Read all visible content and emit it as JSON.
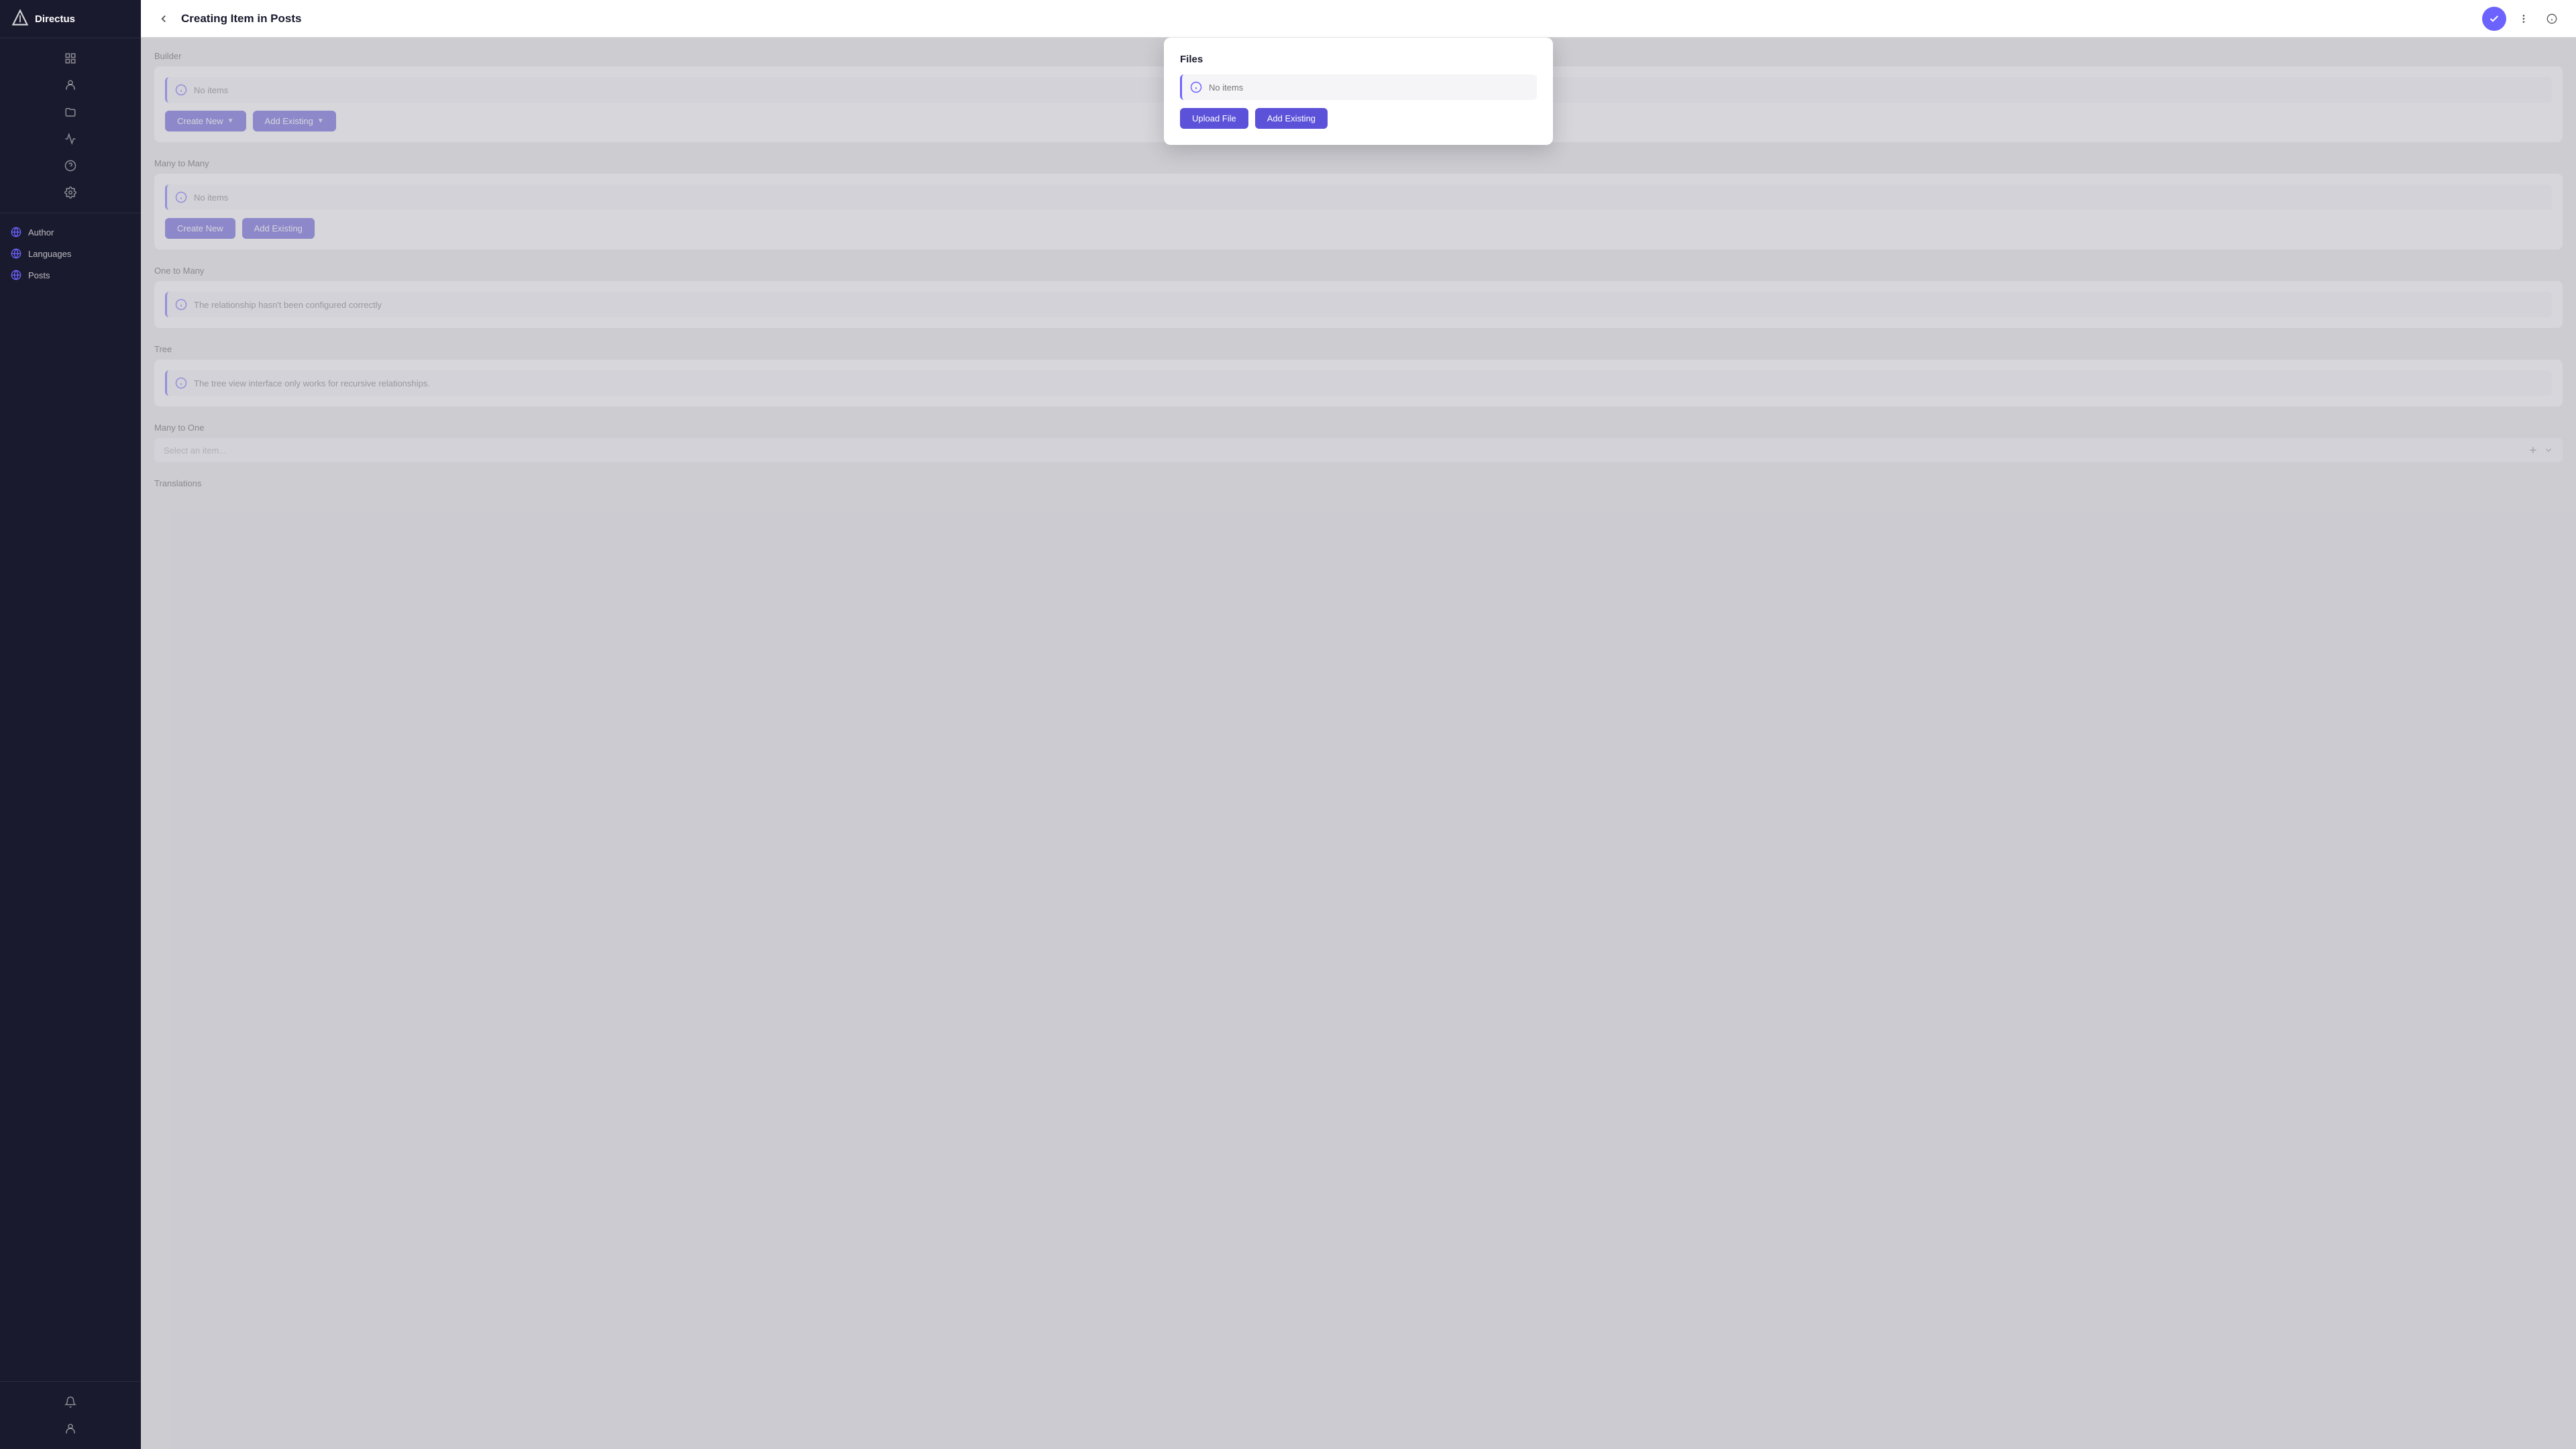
{
  "app": {
    "name": "Directus"
  },
  "header": {
    "title": "Creating Item in Posts",
    "back_label": "Back"
  },
  "sidebar": {
    "items": [
      {
        "id": "author",
        "label": "Author"
      },
      {
        "id": "languages",
        "label": "Languages"
      },
      {
        "id": "posts",
        "label": "Posts"
      }
    ]
  },
  "modal": {
    "title": "Files",
    "no_items": "No items",
    "upload_btn": "Upload File",
    "add_existing_btn": "Add Existing"
  },
  "sections": [
    {
      "id": "builder",
      "label": "Builder",
      "type": "no_items",
      "message": "No items",
      "btn1": "Create New",
      "btn1_has_chevron": true,
      "btn2": "Add Existing",
      "btn2_has_chevron": true
    },
    {
      "id": "many_to_many",
      "label": "Many to Many",
      "type": "no_items",
      "message": "No items",
      "btn1": "Create New",
      "btn1_has_chevron": false,
      "btn2": "Add Existing",
      "btn2_has_chevron": false
    },
    {
      "id": "one_to_many",
      "label": "One to Many",
      "type": "info",
      "message": "The relationship hasn't been configured correctly"
    },
    {
      "id": "tree",
      "label": "Tree",
      "type": "info",
      "message": "The tree view interface only works for recursive relationships."
    },
    {
      "id": "many_to_one",
      "label": "Many to One",
      "type": "select",
      "placeholder": "Select an item..."
    },
    {
      "id": "translations",
      "label": "Translations"
    }
  ]
}
